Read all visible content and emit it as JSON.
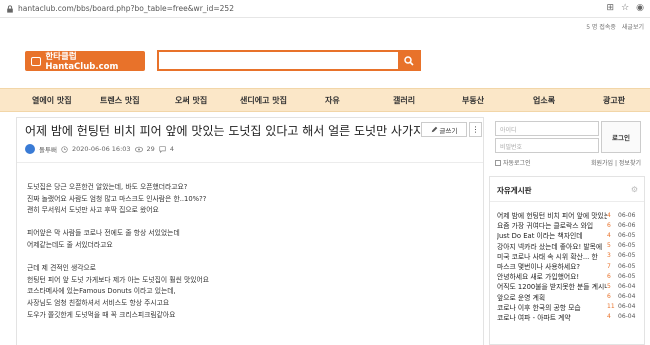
{
  "browser": {
    "url": "hantaclub.com/bbs/board.php?bo_table=free&wr_id=252"
  },
  "top_links": [
    "5 명 접속중",
    "새글보기"
  ],
  "header": {
    "logo_text": "한타클럽 HantaClub.com",
    "search_placeholder": ""
  },
  "nav": [
    "열에이 맛집",
    "트렌스 맛집",
    "오써 맛집",
    "샌디에고 맛집",
    "자유",
    "갤러리",
    "부동산",
    "업소록",
    "광고판"
  ],
  "post": {
    "title": "어제 밤에 헌팅턴 비치 피어 앞에 맛있는 도넛집 있다고 해서 얼른 도넛만 사가지고 왔어요",
    "write_label": "글쓰기",
    "more_label": "⋮",
    "author": "돌투뻐",
    "datetime": "2020-06-06 16:03",
    "views": "29",
    "comments": "4",
    "paragraphs": [
      [
        "도넛집은 당근 오픈한건 알았는데, 바도 오픈했더라고요?",
        "진짜 놀랬어요 사람도 엄청 많고 마스크도 인사람은 한..10%??",
        "괜히 무서워서 도넛만 사고 후딱 집으로 왔어요"
      ],
      [
        "피어앞은 막 사람들 코로나 전에도 줄 항상 서있었는데",
        "어제같는데도 줄 서있더라고요"
      ],
      [
        "근데 제 견적인 생각으로",
        "헌팅턴 피어 앞 도넛 가게보다 제가 아는 도넛집이 훨씬 맛있어요",
        "코스타메사에 있는Famous Donuts 이라고 있는데,",
        "사장님도 엄청 친절하셔서 서비스도 항상 주시고요",
        "도우가 쫄깃한게 도넛먹을 때 꼭 크리스피크림같아요"
      ]
    ]
  },
  "login": {
    "id_placeholder": "아이디",
    "pw_placeholder": "비밀번호",
    "login_label": "로그인",
    "auto_login_label": "자동로그인",
    "links": "회원가입 | 정보찾기"
  },
  "board": {
    "title": "자유게시판",
    "items": [
      {
        "title": "어제 밤에 헌팅턴 비치 피어 앞에 맛있는",
        "count": "4",
        "date": "06-06"
      },
      {
        "title": "요즘 가장 귀여다는 클로락스 와입",
        "count": "6",
        "date": "06-06"
      },
      {
        "title": "Just Do Eat 이라는 책자인데",
        "count": "4",
        "date": "06-05"
      },
      {
        "title": "강아지 넥카라 샀는데 좋아요! 발목에",
        "count": "5",
        "date": "06-05"
      },
      {
        "title": "미국 코로나 사태 속 시위 확산... 한",
        "count": "3",
        "date": "06-05"
      },
      {
        "title": "마스크 몇번이나 사용하세요?",
        "count": "7",
        "date": "06-05"
      },
      {
        "title": "안녕하세요 새로 가입했어요!",
        "count": "6",
        "date": "06-05"
      },
      {
        "title": "어직도 1200불을 받지못한 분들 계시나",
        "count": "5",
        "date": "06-04"
      },
      {
        "title": "앞으로 운영 계획",
        "count": "6",
        "date": "06-04"
      },
      {
        "title": "코로나 이후 한국의 공항 모습",
        "count": "11",
        "date": "06-04"
      },
      {
        "title": "코로나 여파 - 아파트 계약",
        "count": "4",
        "date": "06-04"
      }
    ]
  },
  "colors": {
    "accent": "#e8722a",
    "nav_bg": "#fbe7c8",
    "avatar": "#3a7bd5"
  },
  "icons": [
    "lock-icon",
    "translate-icon",
    "star-icon",
    "profile-icon",
    "search-icon",
    "pencil-icon",
    "clock-icon",
    "eye-icon",
    "comment-icon",
    "gear-icon"
  ]
}
